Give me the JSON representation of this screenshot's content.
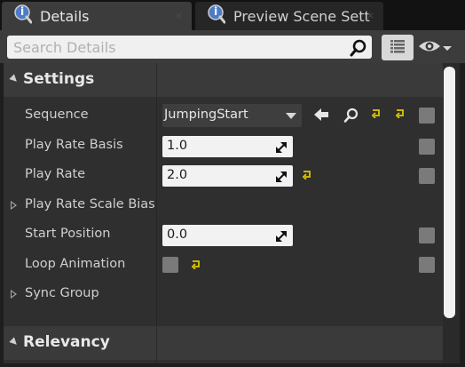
{
  "tabs": [
    {
      "label": "Details",
      "icon": "details-icon",
      "close": "×",
      "active": true
    },
    {
      "label": "Preview Scene Sett",
      "icon": "details-icon",
      "close": "×",
      "active": false
    }
  ],
  "toolbar": {
    "search_placeholder": "Search Details",
    "search_value": "",
    "view_options_icon": "grid-view-icon",
    "visibility_icon": "eye-icon"
  },
  "sections": [
    {
      "title": "Settings",
      "expanded": true,
      "properties": [
        {
          "name": "Sequence",
          "type": "asset",
          "value": "JumpingStart"
        },
        {
          "name": "Play Rate Basis",
          "type": "number",
          "value": "1.0"
        },
        {
          "name": "Play Rate",
          "type": "number",
          "value": "2.0"
        },
        {
          "name": "Play Rate Scale Bias C",
          "type": "group",
          "expanded": false
        },
        {
          "name": "Start Position",
          "type": "number",
          "value": "0.0"
        },
        {
          "name": "Loop Animation",
          "type": "bool",
          "value": false
        },
        {
          "name": "Sync Group",
          "type": "group",
          "expanded": false
        }
      ]
    },
    {
      "title": "Relevancy",
      "expanded": true,
      "properties": []
    }
  ],
  "colors": {
    "background": "#1e1e1e",
    "panel": "#2f2f2f",
    "section_header": "#3a3a3a",
    "field": "#f2f2f2",
    "reset_arrow": "#e0c800"
  }
}
